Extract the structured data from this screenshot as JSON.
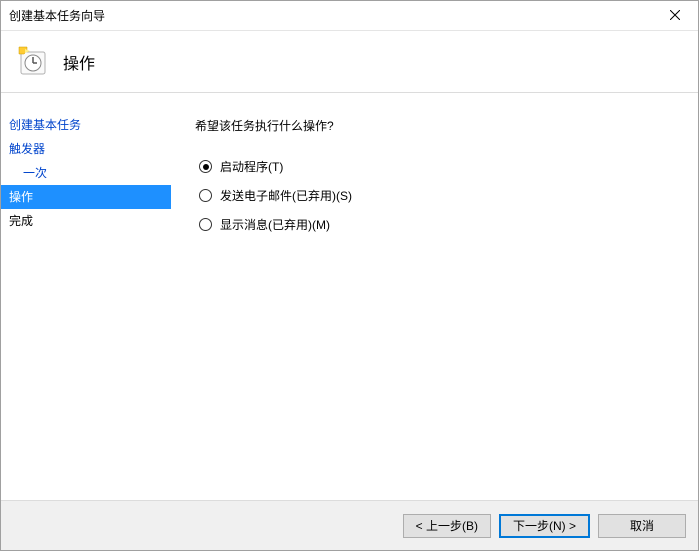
{
  "window": {
    "title": "创建基本任务向导"
  },
  "header": {
    "heading": "操作"
  },
  "sidebar": {
    "items": [
      {
        "label": "创建基本任务",
        "kind": "link"
      },
      {
        "label": "触发器",
        "kind": "link"
      },
      {
        "label": "一次",
        "kind": "sublink"
      },
      {
        "label": "操作",
        "kind": "active"
      },
      {
        "label": "完成",
        "kind": "plain"
      }
    ]
  },
  "content": {
    "question": "希望该任务执行什么操作?",
    "options": [
      {
        "label": "启动程序(T)",
        "selected": true
      },
      {
        "label": "发送电子邮件(已弃用)(S)",
        "selected": false
      },
      {
        "label": "显示消息(已弃用)(M)",
        "selected": false
      }
    ]
  },
  "footer": {
    "back": "< 上一步(B)",
    "next": "下一步(N) >",
    "cancel": "取消"
  }
}
